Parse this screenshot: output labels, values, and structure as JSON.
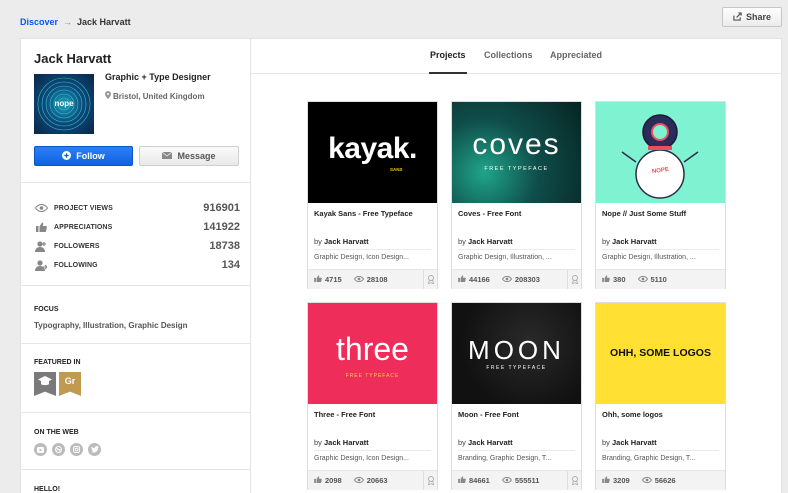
{
  "breadcrumb": {
    "link": "Discover",
    "arrow": "→",
    "current": "Jack Harvatt"
  },
  "share_label": "Share",
  "profile": {
    "name": "Jack Harvatt",
    "avatar_text": "nope",
    "occupation": "Graphic + Type Designer",
    "location": "Bristol, United Kingdom",
    "follow_label": "Follow",
    "message_label": "Message"
  },
  "stats": [
    {
      "label": "PROJECT VIEWS",
      "value": "916901",
      "icon": "eye-icon"
    },
    {
      "label": "APPRECIATIONS",
      "value": "141922",
      "icon": "thumbs-up-icon"
    },
    {
      "label": "FOLLOWERS",
      "value": "18738",
      "icon": "followers-icon"
    },
    {
      "label": "FOLLOWING",
      "value": "134",
      "icon": "following-icon"
    }
  ],
  "focus": {
    "title": "FOCUS",
    "text": "Typography, Illustration, Graphic Design"
  },
  "featured": {
    "title": "FEATURED IN",
    "badges": [
      {
        "icon": "graduation-cap-icon",
        "color": "#7a7a7a"
      },
      {
        "text": "Gr",
        "color": "#c19a52"
      }
    ]
  },
  "web": {
    "title": "ON THE WEB",
    "icons": [
      "youtube-icon",
      "dribbble-icon",
      "instagram-icon",
      "twitter-icon"
    ]
  },
  "hello": {
    "title": "HELLO!"
  },
  "tabs": [
    {
      "label": "Projects",
      "active": true
    },
    {
      "label": "Collections"
    },
    {
      "label": "Appreciated"
    }
  ],
  "by_label": "by",
  "projects": [
    {
      "cover_text": "kayak.",
      "cover_sub": "SANS",
      "title": "Kayak Sans - Free Typeface",
      "author": "Jack Harvatt",
      "fields": "Graphic Design, Icon Design...",
      "likes": "4715",
      "views": "28108",
      "bg": "#000000"
    },
    {
      "cover_text": "coves",
      "cover_sub": "FREE TYPEFACE",
      "title": "Coves - Free Font",
      "author": "Jack Harvatt",
      "fields": "Graphic Design, Illustration, ...",
      "likes": "44166",
      "views": "208303",
      "bg": "#0f4d4a"
    },
    {
      "cover_text": "NOPE",
      "cover_sub": "",
      "title": "Nope // Just Some Stuff",
      "author": "Jack Harvatt",
      "fields": "Graphic Design, Illustration, ...",
      "likes": "380",
      "views": "5110",
      "bg": "#7ff2d2"
    },
    {
      "cover_text": "three",
      "cover_sub": "FREE TYPEFACE",
      "title": "Three - Free Font",
      "author": "Jack Harvatt",
      "fields": "Graphic Design, Icon Design...",
      "likes": "2098",
      "views": "20663",
      "bg": "#ef2d5b"
    },
    {
      "cover_text": "MOON",
      "cover_sub": "FREE TYPEFACE",
      "title": "Moon - Free Font",
      "author": "Jack Harvatt",
      "fields": "Branding, Graphic Design, T...",
      "likes": "84661",
      "views": "555511",
      "bg": "#111111"
    },
    {
      "cover_text": "OHH, SOME LOGOS",
      "cover_sub": "",
      "title": "Ohh, some logos",
      "author": "Jack Harvatt",
      "fields": "Branding, Graphic Design, T...",
      "likes": "3209",
      "views": "56626",
      "bg": "#ffe033"
    }
  ]
}
